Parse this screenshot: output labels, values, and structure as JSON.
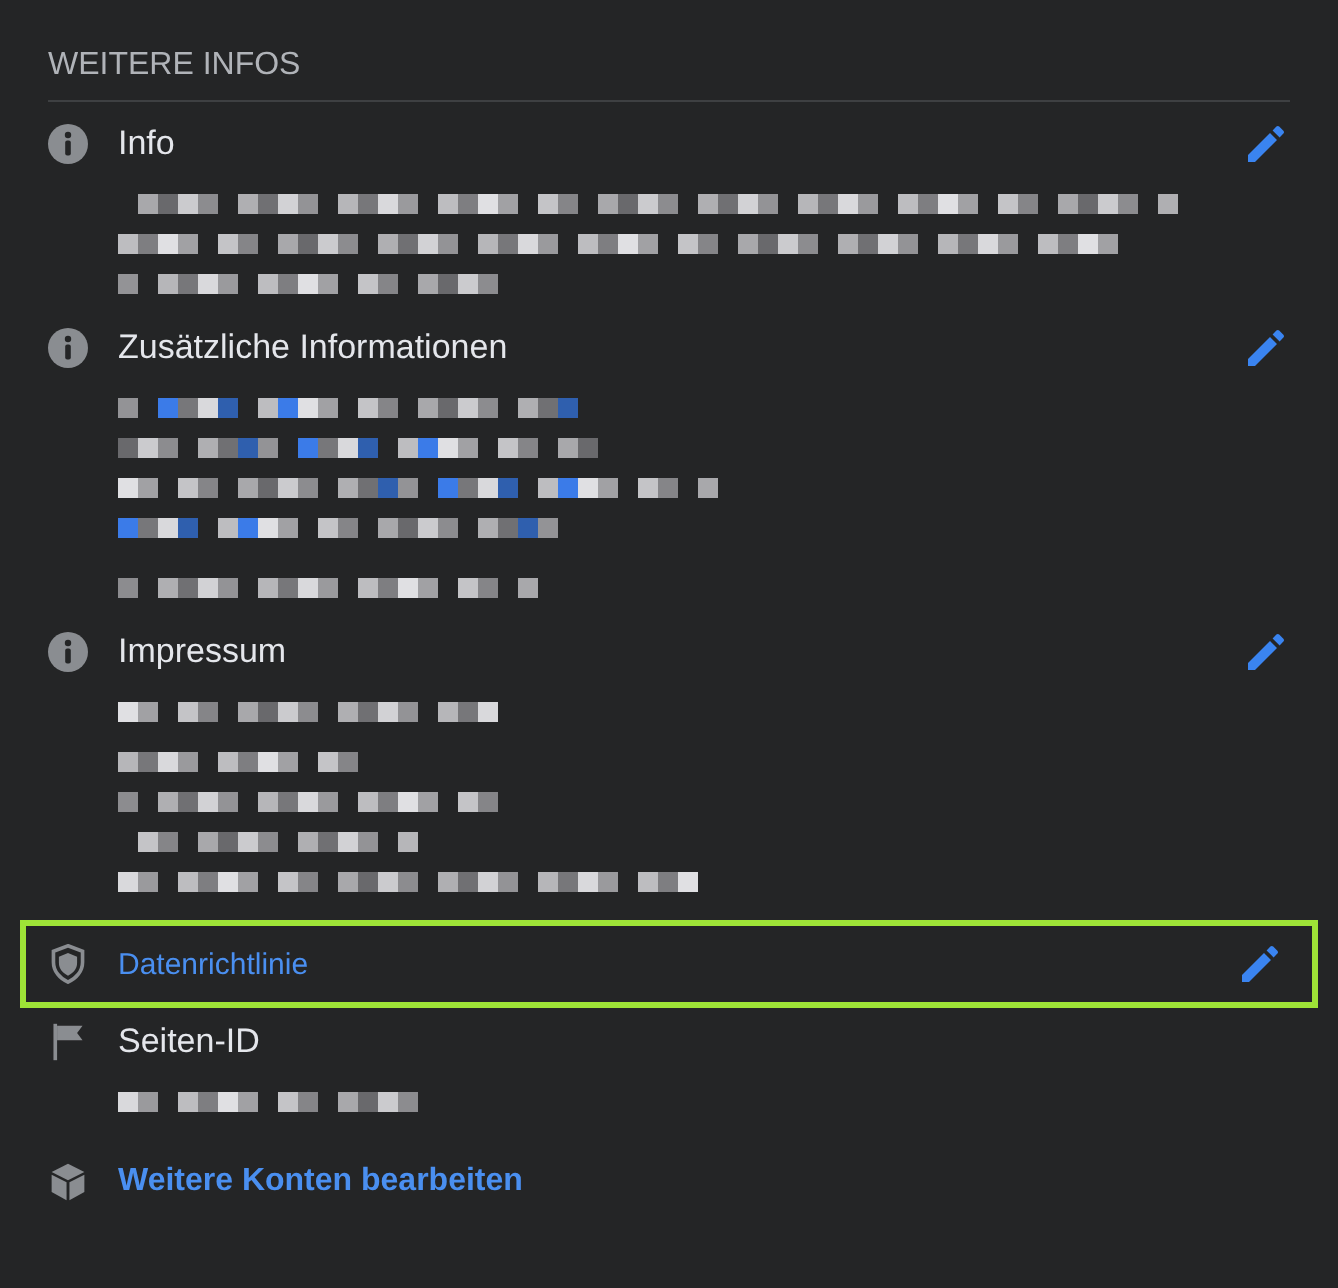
{
  "heading": "WEITERE INFOS",
  "items": [
    {
      "kind": "info",
      "title": "Info",
      "editable": true,
      "highlighted": false,
      "link": false,
      "redacted": true
    },
    {
      "kind": "info",
      "title": "Zusätzliche Informationen",
      "editable": true,
      "highlighted": false,
      "link": false,
      "redacted": true
    },
    {
      "kind": "info",
      "title": "Impressum",
      "editable": true,
      "highlighted": false,
      "link": false,
      "redacted": true
    },
    {
      "kind": "policy",
      "title": "Datenrichtlinie",
      "editable": true,
      "highlighted": true,
      "link": true,
      "redacted": false
    },
    {
      "kind": "flag",
      "title": "Seiten-ID",
      "editable": false,
      "highlighted": false,
      "link": false,
      "redacted": true
    }
  ],
  "footer_link": {
    "kind": "cube",
    "label": "Weitere Konten bearbeiten"
  }
}
